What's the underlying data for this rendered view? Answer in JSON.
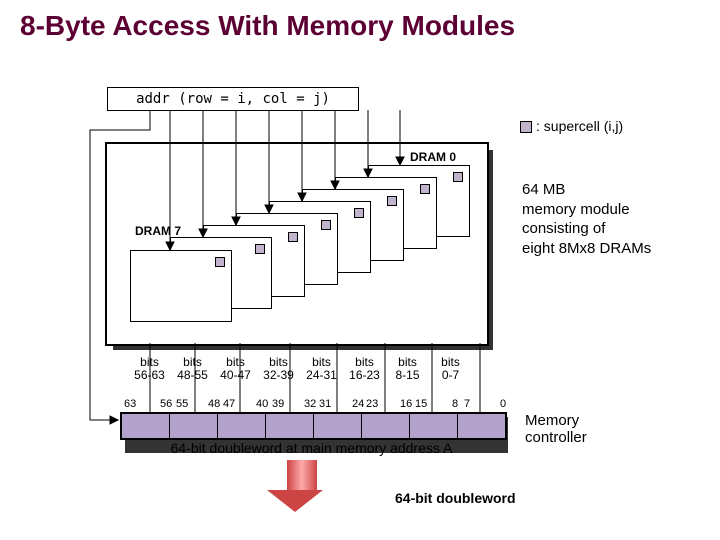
{
  "title": "8-Byte Access With Memory Modules",
  "addr": "addr (row = i, col = j)",
  "legend": ": supercell (i,j)",
  "dram0": "DRAM 0",
  "dram7": "DRAM 7",
  "module_desc_l1": "64 MB",
  "module_desc_l2": "memory module",
  "module_desc_l3": "consisting of",
  "module_desc_l4": "eight 8Mx8 DRAMs",
  "bits_word": "bits",
  "ranges": [
    "56-63",
    "48-55",
    "40-47",
    "32-39",
    "24-31",
    "16-23",
    "8-15",
    "0-7"
  ],
  "bitnums": [
    "63",
    "56",
    "55",
    "48",
    "47",
    "40",
    "39",
    "32",
    "31",
    "24",
    "23",
    "16",
    "15",
    "8",
    "7",
    "0"
  ],
  "word_label": "64-bit doubleword at main memory address A",
  "mc": "Memory",
  "mc2": "controller",
  "dw_out": "64-bit doubleword"
}
